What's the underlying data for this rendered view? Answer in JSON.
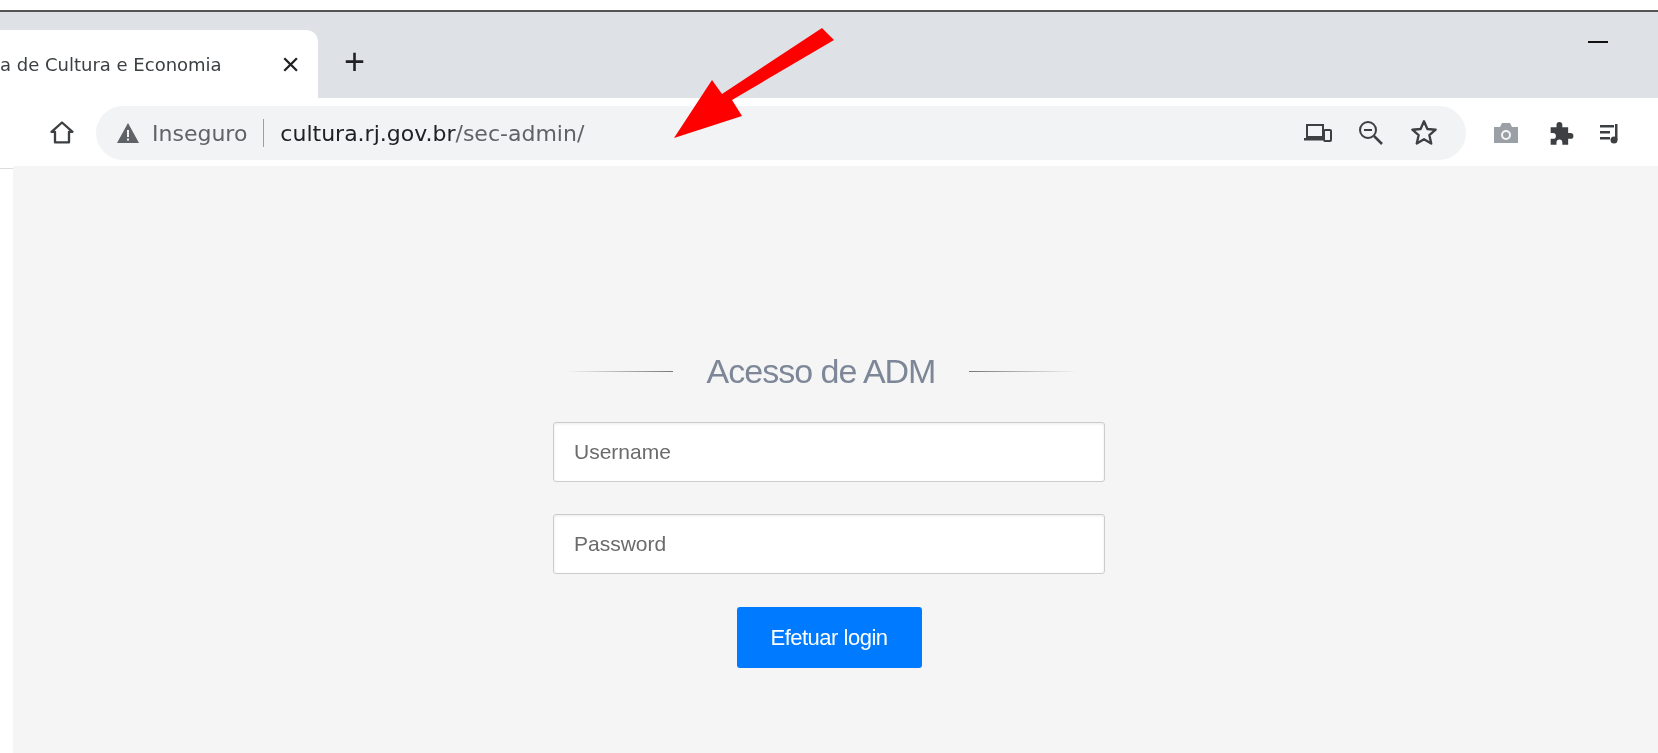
{
  "tab": {
    "title": "a de Cultura e Economia",
    "close": "×"
  },
  "new_tab": "+",
  "address_bar": {
    "security": "Inseguro",
    "host": "cultura.rj.gov.br",
    "path": "/sec-admin/"
  },
  "login": {
    "title": "Acesso de ADM",
    "fields": [
      {
        "placeholder": "Username"
      },
      {
        "placeholder": "Password"
      }
    ],
    "button": "Efetuar login"
  }
}
